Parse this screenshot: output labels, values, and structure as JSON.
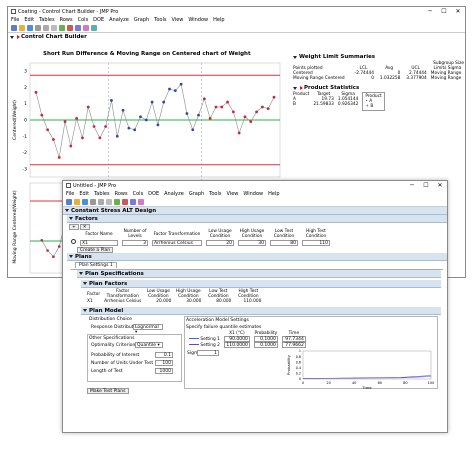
{
  "back": {
    "title": "Coating - Control Chart Builder - JMP Pro",
    "menus": [
      "File",
      "Edit",
      "Tables",
      "Rows",
      "Cols",
      "DOE",
      "Analyze",
      "Graph",
      "Tools",
      "View",
      "Window",
      "Help"
    ],
    "section_title": "Control Chart Builder",
    "chart_title": "Short Run Difference & Moving Range on Centered chart of Weight",
    "y_label_top": "Centered(Weight)",
    "y_label_bottom": "Moving Range Centered(Weight)",
    "y_ticks": [
      "3",
      "2",
      "1",
      "0",
      "-1",
      "-2",
      "-3"
    ],
    "limits_title": "Weight Limit Summaries",
    "subgroup_header": "Subgroup Size",
    "limits_cols": [
      "Points plotted",
      "LCL",
      "Avg",
      "UCL",
      "Limits Sigma"
    ],
    "limits_rows": [
      [
        "Centered",
        "-2.74444",
        "0",
        "2.74444",
        "Moving Range"
      ],
      [
        "Moving Range Centered",
        "0",
        "1.032258",
        "3.377904",
        "Moving Range"
      ]
    ],
    "product_title": "Product Statistics",
    "product_cols": [
      "Product",
      "Target",
      "Sigma"
    ],
    "product_rows": [
      [
        "A",
        "19.73",
        "1.054144"
      ],
      [
        "B",
        "21.59833",
        "0.926342"
      ]
    ],
    "legend_title": "Product",
    "legend_items": [
      "A",
      "B"
    ],
    "colors": {
      "ucl": "#e0303a",
      "center": "#2ab04a",
      "line": "#8c8c8c",
      "pointA": "#c8283c",
      "pointB": "#3048a8"
    }
  },
  "front": {
    "title": "Untitled - JMP Pro",
    "menus": [
      "File",
      "Edit",
      "Tables",
      "Rows",
      "Cols",
      "DOE",
      "Analyze",
      "Graph",
      "Tools",
      "View",
      "Window",
      "Help"
    ],
    "design_title": "Constant Stress ALT Design",
    "factors_title": "Factors",
    "factor_cols": [
      "Factor Name",
      "Number of Levels",
      "Factor Transformation",
      "Low Usage Condition",
      "High Usage Condition",
      "Low Test Condition",
      "High Test Condition"
    ],
    "factor_row": {
      "name": "X1",
      "levels": "3",
      "transform": "Arrhenius Celsius",
      "low_usage": "20",
      "high_usage": "30",
      "low_test": "80",
      "high_test": "110"
    },
    "create_plan_label": "Create a Plan",
    "plans_title": "Plans",
    "plan_tab": "Plan Settings 1",
    "plan_spec_title": "Plan Specifications",
    "plan_factors_title": "Plan Factors",
    "plan_factor_cols": [
      "Factor",
      "Factor Transformation",
      "Low Usage Condition",
      "High Usage Condition",
      "Low Test Condition",
      "High Test Condition"
    ],
    "plan_factor_row": [
      "X1",
      "Arrhenius Celsius",
      "20.000",
      "30.000",
      "80.000",
      "110.000"
    ],
    "plan_model_title": "Plan Model",
    "dist_choice": "Distribution Choice",
    "resp_dist_label": "Response Distribution",
    "resp_dist_value": "Lognormal",
    "other_spec": "Other Specifications",
    "opt_label": "Optimality Criterion",
    "opt_value": "Quantile",
    "prob_label": "Probability of Interest",
    "prob_value": "0.1",
    "units_label": "Number of Units Under Test",
    "units_value": "100",
    "length_label": "Length of Test",
    "length_value": "1000",
    "make_label": "Make Test Plans",
    "accel_title": "Acceleration Model Settings",
    "accel_sub": "Specify failure quantile estimates",
    "accel_cols": [
      "X1 (°C)",
      "Probability",
      "Time"
    ],
    "accel_rows": [
      {
        "name": "Setting 1",
        "x": "90.0000",
        "p": "0.1000",
        "t": "97.7344"
      },
      {
        "name": "Setting 2",
        "x": "110.0000",
        "p": "0.1000",
        "t": "77.9662"
      }
    ],
    "sigma_label": "Sigma",
    "sigma_value": "1",
    "plot_ylabel": "Probability",
    "plot_xlabel": "Time",
    "plot_xticks": [
      "0",
      "20",
      "40",
      "60",
      "80",
      "100"
    ],
    "plot_yticks": [
      "1",
      "0.8",
      "0.6",
      "0.4",
      "0.2",
      "0"
    ]
  },
  "chart_data": {
    "type": "line",
    "title": "Short Run Difference & Moving Range on Centered chart of Weight",
    "ylabel": "Centered(Weight)",
    "ylim": [
      -3.5,
      3.5
    ],
    "ucl": 2.74444,
    "lcl": -2.74444,
    "center": 0,
    "series": [
      {
        "name": "Centered",
        "values": [
          1.7,
          0.3,
          -0.6,
          -1.2,
          -2.3,
          -0.1,
          -1.6,
          0.1,
          -1.1,
          0.8,
          -0.4,
          -1.1,
          -0.4,
          1.2,
          -1.0,
          0.6,
          -0.5,
          -0.6,
          0.2,
          0.0,
          1.1,
          -0.3,
          1.1,
          1.9,
          1.8,
          2.2,
          0.4,
          -0.6,
          0.3,
          1.3,
          0.1,
          0.8,
          0.8,
          1.1,
          0.5,
          -0.8,
          0.2,
          -0.1,
          0.5,
          0.8,
          0.7,
          1.4
        ]
      }
    ],
    "products": [
      "A",
      "A",
      "A",
      "A",
      "A",
      "A",
      "A",
      "A",
      "A",
      "A",
      "A",
      "A",
      "A",
      "B",
      "B",
      "B",
      "B",
      "B",
      "B",
      "B",
      "B",
      "B",
      "B",
      "B",
      "B",
      "B",
      "B",
      "B",
      "B",
      "A",
      "A",
      "A",
      "A",
      "A",
      "A",
      "A",
      "A",
      "A",
      "A",
      "A",
      "A",
      "A"
    ]
  }
}
